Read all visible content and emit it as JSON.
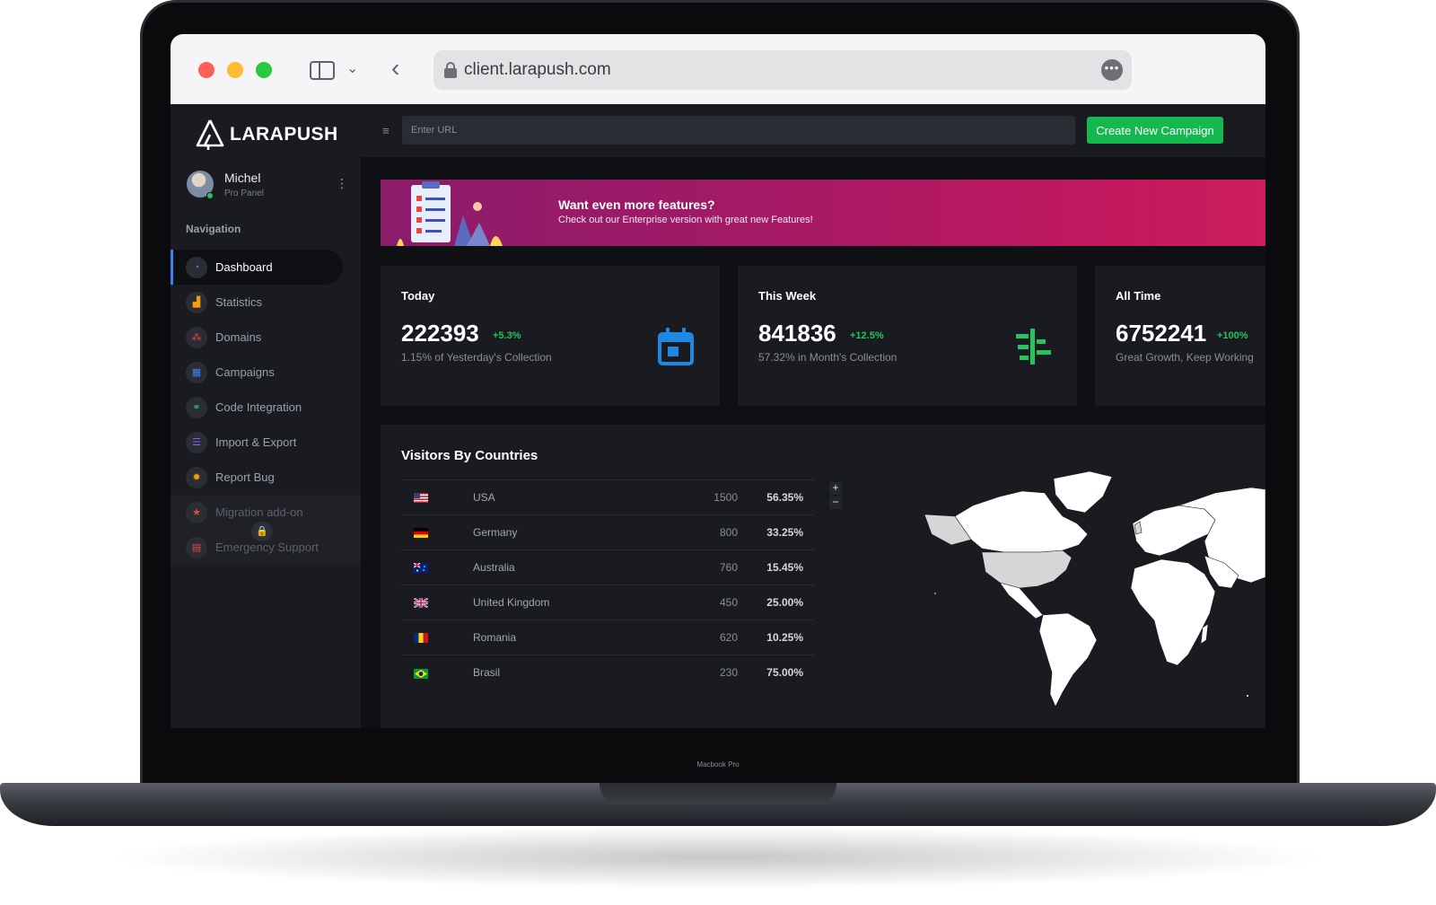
{
  "browser": {
    "url": "client.larapush.com"
  },
  "device": {
    "model_label": "Macbook Pro"
  },
  "brand": {
    "name": "LARAPUSH"
  },
  "user": {
    "name": "Michel",
    "role": "Pro Panel"
  },
  "sidebar": {
    "heading": "Navigation",
    "items": [
      {
        "label": "Dashboard",
        "icon": "gauge-icon",
        "color": "#8b5cf6",
        "glyph": "◔"
      },
      {
        "label": "Statistics",
        "icon": "bar-chart-icon",
        "color": "#f59e0b",
        "glyph": "▟"
      },
      {
        "label": "Domains",
        "icon": "cluster-icon",
        "color": "#ef4444",
        "glyph": "⁂"
      },
      {
        "label": "Campaigns",
        "icon": "table-icon",
        "color": "#3b82f6",
        "glyph": "▦"
      },
      {
        "label": "Code Integration",
        "icon": "link-icon",
        "color": "#22c55e",
        "glyph": "🔗"
      },
      {
        "label": "Import & Export",
        "icon": "database-icon",
        "color": "#8b5cf6",
        "glyph": "☰"
      },
      {
        "label": "Report Bug",
        "icon": "bug-icon",
        "color": "#f59e0b",
        "glyph": "✹"
      },
      {
        "label": "Migration add-on",
        "icon": "star-icon",
        "color": "#ef4444",
        "glyph": "★"
      },
      {
        "label": "Emergency Support",
        "icon": "support-icon",
        "color": "#ef4444",
        "glyph": "▤"
      }
    ]
  },
  "topbar": {
    "url_placeholder": "Enter URL",
    "create_label": "Create New Campaign"
  },
  "banner": {
    "title": "Want even more features?",
    "subtitle": "Check out our Enterprise version with great new Features!"
  },
  "stats": [
    {
      "title": "Today",
      "value": "222393",
      "change": "+5.3%",
      "sub": "1.15% of Yesterday's Collection",
      "icon": "calendar-icon",
      "color": "#1e88e5"
    },
    {
      "title": "This Week",
      "value": "841836",
      "change": "+12.5%",
      "sub": "57.32% in Month's Collection",
      "icon": "timeline-icon",
      "color": "#22c55e"
    },
    {
      "title": "All Time",
      "value": "6752241",
      "change": "+100%",
      "sub": "Great Growth, Keep Working",
      "icon": "",
      "color": "#22c55e"
    }
  ],
  "countries": {
    "title": "Visitors By Countries",
    "rows": [
      {
        "flag": "us-flag-icon",
        "name": "USA",
        "count": "1500",
        "percent": "56.35%"
      },
      {
        "flag": "de-flag-icon",
        "name": "Germany",
        "count": "800",
        "percent": "33.25%"
      },
      {
        "flag": "au-flag-icon",
        "name": "Australia",
        "count": "760",
        "percent": "15.45%"
      },
      {
        "flag": "gb-flag-icon",
        "name": "United Kingdom",
        "count": "450",
        "percent": "25.00%"
      },
      {
        "flag": "ro-flag-icon",
        "name": "Romania",
        "count": "620",
        "percent": "10.25%"
      },
      {
        "flag": "br-flag-icon",
        "name": "Brasil",
        "count": "230",
        "percent": "75.00%"
      }
    ],
    "zoom_in": "+",
    "zoom_out": "−"
  }
}
